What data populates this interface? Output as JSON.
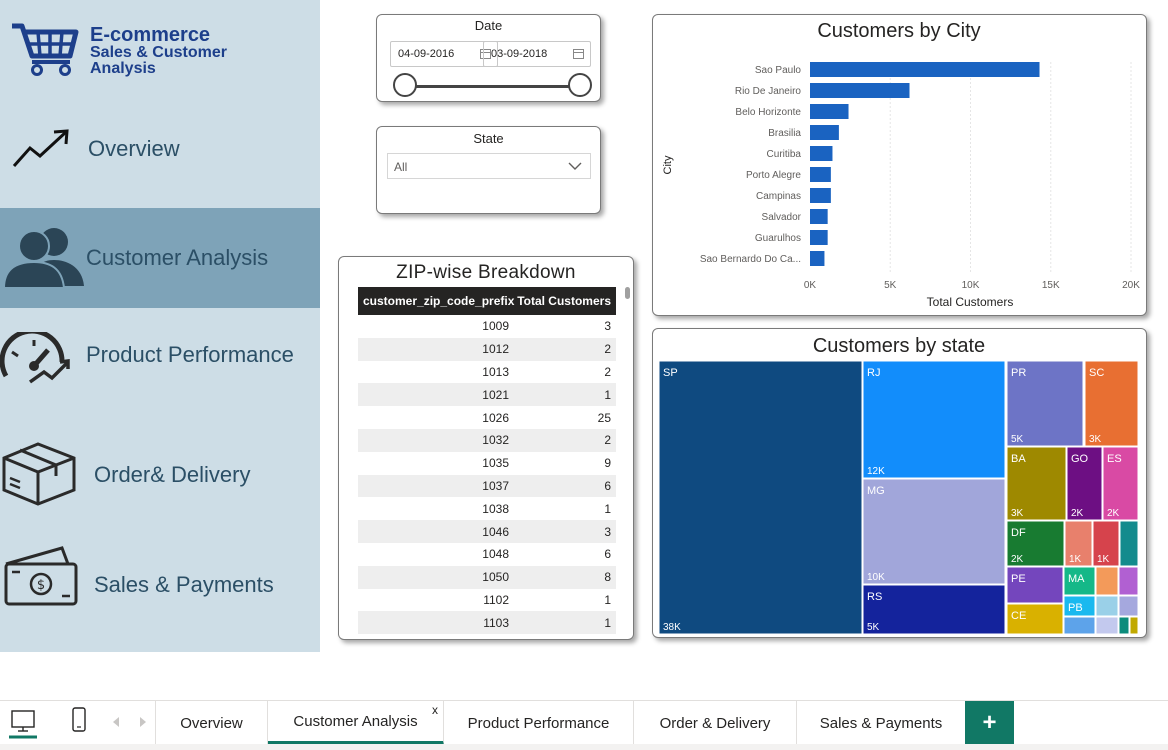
{
  "logo": {
    "line1": "E-commerce",
    "line2": "Sales & Customer",
    "line3": "Analysis"
  },
  "nav": [
    {
      "label": "Overview",
      "icon": "trend-up-icon",
      "active": false
    },
    {
      "label": "Customer Analysis",
      "icon": "users-icon",
      "active": true
    },
    {
      "label": "Product Performance",
      "icon": "speedometer-icon",
      "active": false
    },
    {
      "label": "Order& Delivery",
      "icon": "package-icon",
      "active": false
    },
    {
      "label": "Sales & Payments",
      "icon": "cash-icon",
      "active": false
    }
  ],
  "date_slicer": {
    "title": "Date",
    "start": "04-09-2016",
    "end": "03-09-2018"
  },
  "state_slicer": {
    "title": "State",
    "value": "All"
  },
  "zip_table": {
    "title": "ZIP-wise Breakdown",
    "headers": [
      "customer_zip_code_prefix",
      "Total Customers"
    ],
    "rows": [
      [
        "1009",
        "3"
      ],
      [
        "1012",
        "2"
      ],
      [
        "1013",
        "2"
      ],
      [
        "1021",
        "1"
      ],
      [
        "1026",
        "25"
      ],
      [
        "1032",
        "2"
      ],
      [
        "1035",
        "9"
      ],
      [
        "1037",
        "6"
      ],
      [
        "1038",
        "1"
      ],
      [
        "1046",
        "3"
      ],
      [
        "1048",
        "6"
      ],
      [
        "1050",
        "8"
      ],
      [
        "1102",
        "1"
      ],
      [
        "1103",
        "1"
      ]
    ]
  },
  "chart_data": [
    {
      "type": "bar",
      "orientation": "horizontal",
      "title": "Customers by City",
      "xlabel": "Total Customers",
      "ylabel": "City",
      "categories": [
        "Sao Paulo",
        "Rio De Janeiro",
        "Belo Horizonte",
        "Brasilia",
        "Curitiba",
        "Porto Alegre",
        "Campinas",
        "Salvador",
        "Guarulhos",
        "Sao Bernardo Do Ca..."
      ],
      "values": [
        14300,
        6200,
        2400,
        1800,
        1400,
        1300,
        1300,
        1100,
        1100,
        900
      ],
      "xlim": [
        0,
        20000
      ],
      "xticks": [
        "0K",
        "5K",
        "10K",
        "15K",
        "20K"
      ],
      "color": "#1a63c1"
    },
    {
      "type": "treemap",
      "title": "Customers by state",
      "items": [
        {
          "label": "SP",
          "value_label": "38K",
          "value": 38000,
          "color": "#0f4a80"
        },
        {
          "label": "RJ",
          "value_label": "12K",
          "value": 12000,
          "color": "#128dfb"
        },
        {
          "label": "MG",
          "value_label": "10K",
          "value": 10000,
          "color": "#a1a6da"
        },
        {
          "label": "RS",
          "value_label": "5K",
          "value": 5000,
          "color": "#14239c"
        },
        {
          "label": "PR",
          "value_label": "5K",
          "value": 5000,
          "color": "#6d74c6"
        },
        {
          "label": "SC",
          "value_label": "3K",
          "value": 3000,
          "color": "#e86f32"
        },
        {
          "label": "BA",
          "value_label": "3K",
          "value": 3000,
          "color": "#9e8900"
        },
        {
          "label": "GO",
          "value_label": "2K",
          "value": 2000,
          "color": "#6d0f83"
        },
        {
          "label": "ES",
          "value_label": "2K",
          "value": 2000,
          "color": "#d94aa4"
        },
        {
          "label": "DF",
          "value_label": "2K",
          "value": 2000,
          "color": "#187b31"
        },
        {
          "label": "",
          "value_label": "1K",
          "value": 1000,
          "color": "#e8806c"
        },
        {
          "label": "",
          "value_label": "1K",
          "value": 1000,
          "color": "#d6434c"
        },
        {
          "label": "PE",
          "value_label": "",
          "value": 1600,
          "color": "#7446bd"
        },
        {
          "label": "MA",
          "value_label": "",
          "value": 1000,
          "color": "#15b888"
        },
        {
          "label": "CE",
          "value_label": "",
          "value": 1300,
          "color": "#d9b100"
        },
        {
          "label": "PB",
          "value_label": "",
          "value": 500,
          "color": "#1ab9ef"
        }
      ]
    }
  ],
  "tabs": [
    {
      "label": "Overview",
      "active": false
    },
    {
      "label": "Customer Analysis",
      "active": true,
      "close": "x"
    },
    {
      "label": "Product Performance",
      "active": false
    },
    {
      "label": "Order & Delivery",
      "active": false
    },
    {
      "label": "Sales & Payments",
      "active": false
    }
  ],
  "add_tab_label": "+"
}
